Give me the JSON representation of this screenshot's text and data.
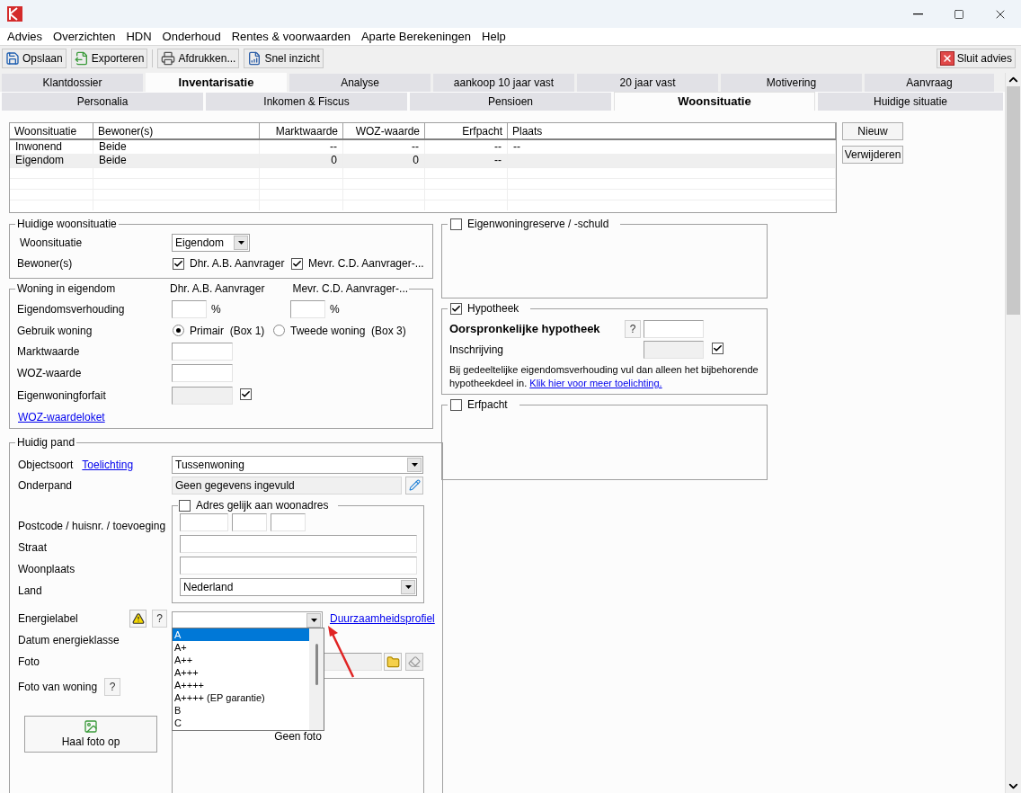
{
  "menu": [
    "Advies",
    "Overzichten",
    "HDN",
    "Onderhoud",
    "Rentes & voorwaarden",
    "Aparte Berekeningen",
    "Help"
  ],
  "toolbar": {
    "buttons": [
      {
        "kind": "save",
        "label": "Opslaan"
      },
      {
        "kind": "export",
        "label": "Exporteren"
      },
      {
        "kind": "print",
        "label": "Afdrukken..."
      },
      {
        "kind": "report",
        "label": "Snel inzicht"
      }
    ],
    "close_label": "Sluit advies"
  },
  "main_tabs": [
    {
      "label": "Klantdossier",
      "selected": false
    },
    {
      "label": "Inventarisatie",
      "selected": true
    },
    {
      "label": "Analyse",
      "selected": false
    },
    {
      "label": "aankoop 10 jaar vast",
      "selected": false
    },
    {
      "label": "20 jaar vast",
      "selected": false
    },
    {
      "label": "Motivering",
      "selected": false
    },
    {
      "label": "Aanvraag",
      "selected": false
    }
  ],
  "sub_tabs": [
    {
      "label": "Personalia",
      "selected": false
    },
    {
      "label": "Inkomen & Fiscus",
      "selected": false
    },
    {
      "label": "Pensioen",
      "selected": false
    },
    {
      "label": "Woonsituatie",
      "selected": true
    },
    {
      "label": "Huidige situatie",
      "selected": false
    }
  ],
  "table": {
    "columns": [
      {
        "label": "Woonsituatie"
      },
      {
        "label": "Bewoner(s)"
      },
      {
        "label": "Marktwaarde"
      },
      {
        "label": "WOZ-waarde"
      },
      {
        "label": "Erfpacht"
      },
      {
        "label": "Plaats"
      }
    ],
    "rows": [
      {
        "cells": [
          "Inwonend",
          "Beide",
          "--",
          "--",
          "--",
          "--"
        ],
        "selected": false
      },
      {
        "cells": [
          "Eigendom",
          "Beide",
          "0",
          "0",
          "--"
        ],
        "selected": true
      }
    ]
  },
  "table_buttons": [
    "Nieuw",
    "Verwijderen"
  ],
  "huidige_woonsituatie": {
    "title": "Huidige woonsituatie",
    "woonsituatie_label": "Woonsituatie",
    "woonsituatie_value": "Eigendom",
    "bewoners_label": "Bewoner(s)",
    "bewoners": [
      {
        "label": "Dhr. A.B. Aanvrager",
        "checked": true
      },
      {
        "label": "Mevr. C.D. Aanvrager-...",
        "checked": true
      }
    ]
  },
  "woning_in_eigendom": {
    "title": "Woning in eigendom",
    "persons": [
      "Dhr. A.B. Aanvrager",
      "Mevr. C.D. Aanvrager-..."
    ],
    "eigendomsverhouding_label": "Eigendomsverhouding",
    "units": [
      "%",
      "%"
    ],
    "gebruik_label": "Gebruik woning",
    "gebruik_options": [
      {
        "label": "Primair  (Box 1)",
        "selected": true
      },
      {
        "label": "Tweede woning  (Box 3)",
        "selected": false
      }
    ],
    "marktwaarde_label": "Marktwaarde",
    "woz_label": "WOZ-waarde",
    "forfait": {
      "label": "Eigenwoningforfait",
      "checked": true
    },
    "link": "WOZ-waardeloket"
  },
  "huidig_pand": {
    "title": "Huidig pand",
    "objectsoort": {
      "label": "Objectsoort",
      "link": "Toelichting",
      "value": "Tussenwoning"
    },
    "onderpand": {
      "label": "Onderpand",
      "value": "Geen gegevens ingevuld"
    },
    "adres": {
      "title": "Adres gelijk aan woonadres",
      "checked": false,
      "postcode_label": "Postcode / huisnr. / toevoeging",
      "straat_label": "Straat",
      "woonplaats_label": "Woonplaats",
      "land_label": "Land",
      "land_value": "Nederland"
    },
    "energielabel": {
      "label": "Energielabel",
      "help": "?",
      "link": "Duurzaamheidsprofiel",
      "options": [
        {
          "label": "A",
          "selected": true
        },
        {
          "label": "A+",
          "selected": false
        },
        {
          "label": "A++",
          "selected": false
        },
        {
          "label": "A+++",
          "selected": false
        },
        {
          "label": "A++++",
          "selected": false
        },
        {
          "label": "A++++ (EP garantie)",
          "selected": false
        },
        {
          "label": "B",
          "selected": false
        },
        {
          "label": "C",
          "selected": false
        }
      ]
    },
    "datum_label": "Datum energieklasse",
    "foto_label": "Foto",
    "foto_van_woning": {
      "label": "Foto van woning",
      "help": "?"
    },
    "haal_foto": "Haal foto op",
    "geen_foto": "Geen foto"
  },
  "eigenwoningreserve": {
    "title": "Eigenwoningreserve / -schuld",
    "checked": false
  },
  "hypotheek": {
    "title": "Hypotheek",
    "checked": true,
    "oorspronkelijk_label": "Oorspronkelijke hypotheek",
    "help": "?",
    "inschrijving": {
      "label": "Inschrijving",
      "checked": true
    },
    "note": "Bij gedeeltelijke eigendomsverhouding vul dan alleen het bijbehorende hypotheekdeel in.",
    "note_link": "Klik hier voor meer toelichting."
  },
  "erfpacht": {
    "title": "Erfpacht",
    "checked": false
  }
}
